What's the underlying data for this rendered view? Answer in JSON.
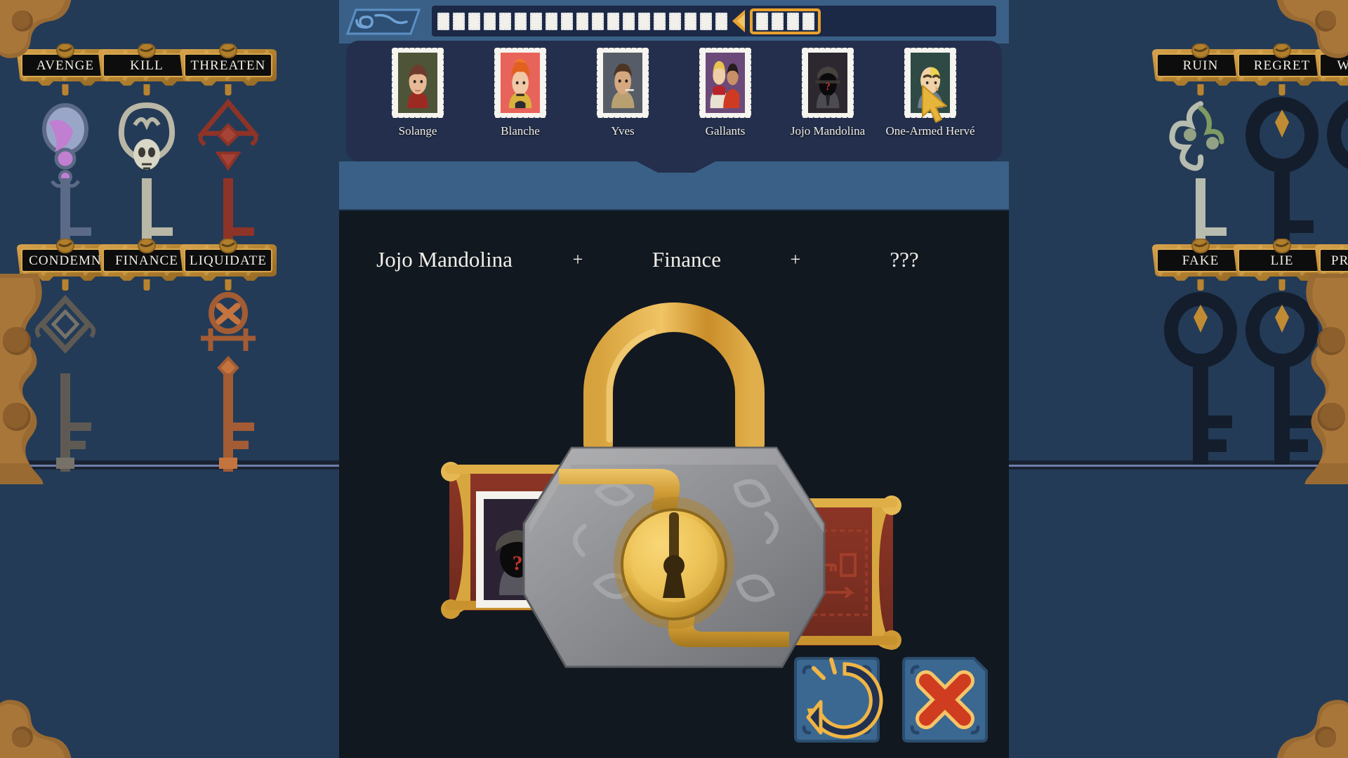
{
  "theme": {
    "background": "#233b57",
    "panel_navy": "#232f4c",
    "bar_blue": "#3a6087",
    "stage_black": "#111820",
    "brass": "#c08b33",
    "brass_light": "#e0b45f",
    "gold_accent": "#e8a22e",
    "plaque_black": "#121212",
    "text_cream": "#f2efe7",
    "red_accent": "#d03a22"
  },
  "header": {
    "emblem_icon": "scroll-wave-emblem",
    "progress": {
      "total_slots": 24,
      "filled_before_marker": 19,
      "marker_icon": "arrow-left-marker",
      "current_group_slots": 4,
      "current_index_label": "20"
    }
  },
  "characters": {
    "items": [
      {
        "name": "Solange",
        "icon": "stamp-portrait-solange",
        "bg": "#4e5438",
        "selected": false
      },
      {
        "name": "Blanche",
        "icon": "stamp-portrait-blanche",
        "bg": "#e8635a",
        "selected": false
      },
      {
        "name": "Yves",
        "icon": "stamp-portrait-yves",
        "bg": "#565d68",
        "selected": false
      },
      {
        "name": "Gallants",
        "icon": "stamp-portrait-gallants",
        "bg": "#6b4a7a",
        "selected": false
      },
      {
        "name": "Jojo Mandolina",
        "icon": "stamp-portrait-unknown",
        "bg": "#2d2730",
        "selected": true
      },
      {
        "name": "One-Armed Hervé",
        "icon": "stamp-portrait-herve",
        "bg": "#2f4a44",
        "selected": false
      }
    ]
  },
  "formula": {
    "subject": "Jojo Mandolina",
    "plus_1": "+",
    "action": "Finance",
    "plus_2": "+",
    "target": "???"
  },
  "lock": {
    "icon": "padlock-large",
    "left_scroll_icon": "scroll-portrait-unknown",
    "right_scroll_icon": "scroll-key-diagram",
    "keyhole_icon": "keyhole-icon"
  },
  "left_panel": {
    "top_row": [
      {
        "label": "AVENGE",
        "key_icon": "key-orb-violet",
        "key_style": "orb-violet",
        "has_key": true
      },
      {
        "label": "KILL",
        "key_icon": "key-skull-bone",
        "key_style": "skull-bone",
        "has_key": true
      },
      {
        "label": "THREATEN",
        "key_icon": "key-spear-crimson",
        "key_style": "spear-crimson",
        "has_key": true
      }
    ],
    "bottom_row": [
      {
        "label": "CONDEMN",
        "key_icon": "key-chain-iron",
        "key_style": "chain-iron",
        "has_key": true
      },
      {
        "label": "FINANCE",
        "key_icon": "key-empty-hook",
        "key_style": "none",
        "has_key": false
      },
      {
        "label": "LIQUIDATE",
        "key_icon": "key-cross-copper",
        "key_style": "cross-copper",
        "has_key": true
      }
    ]
  },
  "right_panel": {
    "top_row": [
      {
        "label": "RUIN",
        "key_icon": "key-vine-jade",
        "key_style": "vine-jade",
        "has_key": true
      },
      {
        "label": "REGRET",
        "key_icon": "key-ring-black",
        "key_style": "ring-black",
        "has_key": true
      },
      {
        "label": "WORRY",
        "key_icon": "key-ring-black",
        "key_style": "ring-black",
        "has_key": true
      }
    ],
    "bottom_row": [
      {
        "label": "FAKE",
        "key_icon": "key-ring-black",
        "key_style": "ring-black",
        "has_key": true
      },
      {
        "label": "LIE",
        "key_icon": "key-ring-black",
        "key_style": "ring-black",
        "has_key": true
      },
      {
        "label": "PROTECT",
        "key_icon": "key-ring-black",
        "key_style": "ring-black",
        "has_key": true
      }
    ]
  },
  "actions": {
    "undo": {
      "label": "Undo",
      "icon": "undo-arrow-icon"
    },
    "cancel": {
      "label": "Cancel",
      "icon": "close-x-icon"
    }
  }
}
